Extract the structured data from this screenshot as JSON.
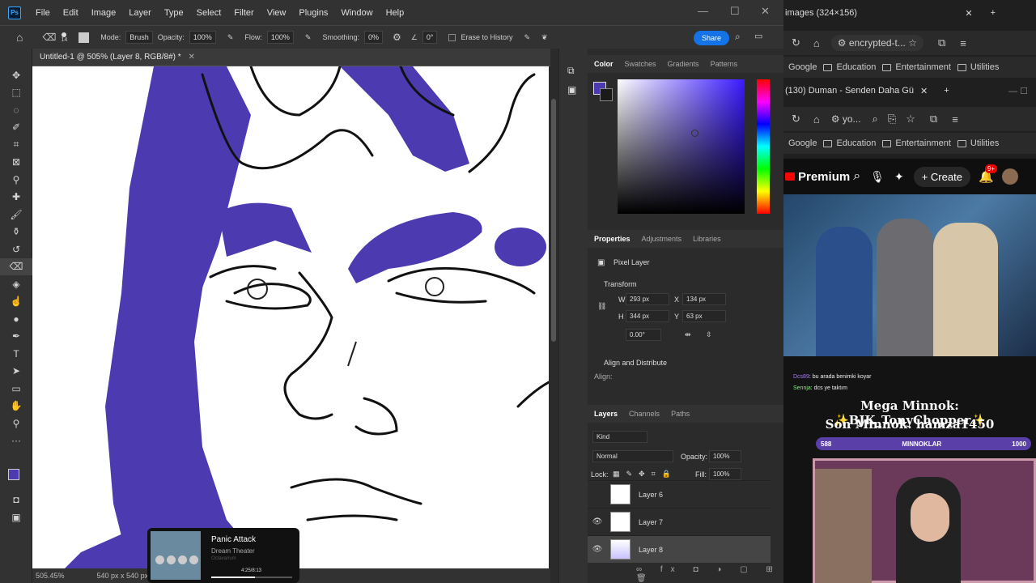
{
  "photoshop": {
    "logo": "Ps",
    "menu": [
      "File",
      "Edit",
      "Image",
      "Layer",
      "Type",
      "Select",
      "Filter",
      "View",
      "Plugins",
      "Window",
      "Help"
    ],
    "options": {
      "mode_label": "Mode:",
      "mode_value": "Brush",
      "brush_size": "14",
      "opacity_label": "Opacity:",
      "opacity_value": "100%",
      "flow_label": "Flow:",
      "flow_value": "100%",
      "smoothing_label": "Smoothing:",
      "smoothing_value": "0%",
      "angle_value": "0°",
      "erase_history_label": "Erase to History",
      "share_label": "Share"
    },
    "document_tab": "Untitled-1 @ 505% (Layer 8, RGB/8#) *",
    "status": {
      "zoom": "505.45%",
      "doc_size": "540 px x 540 px (72"
    },
    "color_panel": {
      "tabs": [
        "Color",
        "Swatches",
        "Gradients",
        "Patterns"
      ],
      "active": "Color",
      "fg_color": "#4b3ab0",
      "bg_color": "#1a1a1a"
    },
    "properties_panel": {
      "tabs": [
        "Properties",
        "Adjustments",
        "Libraries"
      ],
      "layer_type": "Pixel Layer",
      "transform_label": "Transform",
      "w_label": "W",
      "w": "293 px",
      "h_label": "H",
      "h": "344 px",
      "x_label": "X",
      "x": "134 px",
      "y_label": "Y",
      "y": "63 px",
      "angle": "0.00°",
      "align_section": "Align and Distribute",
      "align_label": "Align:"
    },
    "layers_panel": {
      "tabs": [
        "Layers",
        "Channels",
        "Paths"
      ],
      "filter_kind": "Kind",
      "blend_mode": "Normal",
      "opacity_label": "Opacity:",
      "opacity": "100%",
      "lock_label": "Lock:",
      "fill_label": "Fill:",
      "fill": "100%",
      "layers": [
        {
          "name": "Layer 6"
        },
        {
          "name": "Layer 7"
        },
        {
          "name": "Layer 8"
        }
      ]
    },
    "media_player": {
      "title": "Panic Attack",
      "artist": "Dream Theater",
      "album": "Octavarium",
      "time": "4:25/8:13",
      "progress": 0.54
    }
  },
  "browser": {
    "tab1_title": "images (324×156)",
    "url1": "encrypted-t...",
    "bookmarks": [
      "Google",
      "Education",
      "Entertainment",
      "Utilities"
    ],
    "tab2_title": "(130) Duman - Senden Daha Gü",
    "url2": "yo...",
    "youtube": {
      "brand": "Premium",
      "create_label": "Create",
      "notif_count": "9+"
    },
    "stream": {
      "chat": [
        {
          "user": "Dcs89",
          "text": ": bu arada benimki koyar"
        },
        {
          "user": "Sennja",
          "text": ": dcs ye taktım"
        }
      ],
      "mega_line": "Mega Minnok: ✨BJK_TonyChopper✨",
      "son_line": "Son Minnok: hamza1450",
      "goal_current": "588",
      "goal_label": "MINNOKLAR",
      "goal_target": "1000"
    }
  }
}
